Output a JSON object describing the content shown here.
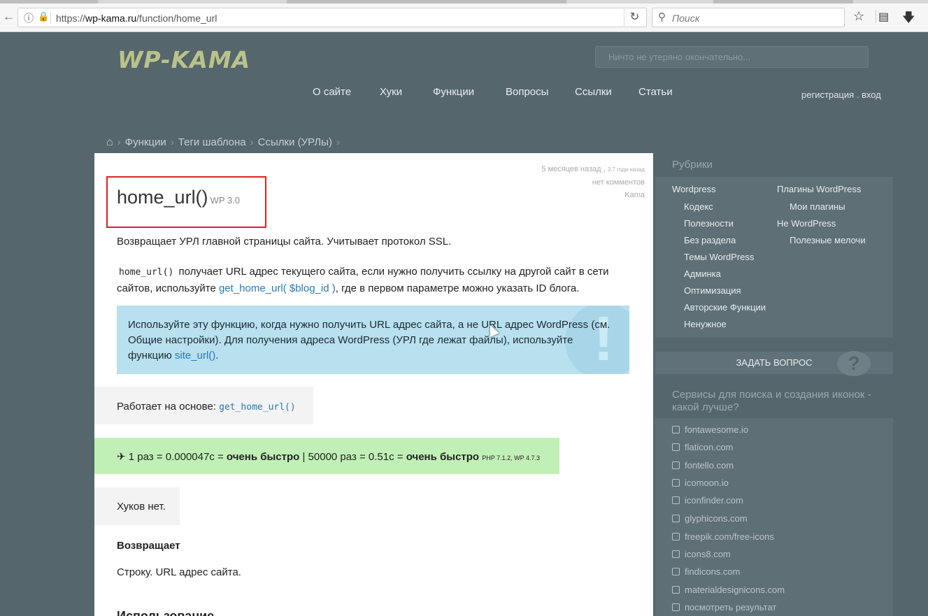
{
  "browser": {
    "url_prefix": "https://",
    "url_domain": "wp-kama.ru",
    "url_path": "/function/home_url",
    "search_placeholder": "Поиск"
  },
  "site": {
    "logo": "WP-KAMA",
    "search_placeholder": "Ничто не утеряно окончательно...",
    "nav": [
      "О сайте",
      "Хуки",
      "Функции",
      "Вопросы",
      "Ссылки",
      "Статьи"
    ],
    "auth": "регистрация . вход"
  },
  "breadcrumb": [
    "Функции",
    "Теги шаблона",
    "Ссылки (УРЛы)"
  ],
  "article": {
    "meta_date": "5 месяцев назад",
    "meta_ago": "3.7 года назад",
    "meta_comments": "нет комментов",
    "meta_author": "Kama",
    "title": "home_url()",
    "version": "WP 3.0",
    "p1": "Возвращает УРЛ главной страницы сайта. Учитывает протокол SSL.",
    "p2_code": "home_url()",
    "p2_a": "получает URL адрес текущего сайта, если нужно получить ссылку на другой сайт в сети сайтов, используйте",
    "p2_link": "get_home_url( $blog_id )",
    "p2_b": ", где в первом параметре можно указать ID блога.",
    "notice_a": "Используйте эту функцию, когда нужно получить URL адрес сайта, а не URL адрес WordPress (см. Общие настройки). Для получения адреса WordPress (УРЛ где лежат файлы), используйте функцию",
    "notice_link": "site_url()",
    "notice_b": ".",
    "based_label": "Работает на основе:",
    "based_code": "get_home_url()",
    "speed_1": "1 раз = 0.000047с =",
    "speed_1b": "очень быстро",
    "speed_2": "| 50000 раз = 0.51с =",
    "speed_2b": "очень быстро",
    "speed_env": "PHP 7.1.2, WP 4.7.3",
    "hooks": "Хуков нет.",
    "returns_heading": "Возвращает",
    "returns_text": "Строку. URL адрес сайта.",
    "usage_heading": "Использование"
  },
  "sidebar": {
    "rubrics_heading": "Рубрики",
    "col1": [
      "Wordpress",
      "Кодекс",
      "Полезности",
      "Без раздела",
      "Темы WordPress",
      "Админка",
      "Оптимизация",
      "Авторские Функции",
      "Ненужное"
    ],
    "col2": [
      "Плагины WordPress",
      "Мои плагины",
      "Не WordPress",
      "Полезные мелочи"
    ],
    "ask_button": "ЗАДАТЬ ВОПРОС",
    "poll_heading": "Сервисы для поиска и создания иконок - какой лучше?",
    "poll_items": [
      "fontawesome.io",
      "flaticon.com",
      "fontello.com",
      "icomoon.io",
      "iconfinder.com",
      "glyphicons.com",
      "freepik.com/free-icons",
      "icons8.com",
      "findicons.com",
      "materialdesignicons.com",
      "посмотреть результат"
    ]
  }
}
